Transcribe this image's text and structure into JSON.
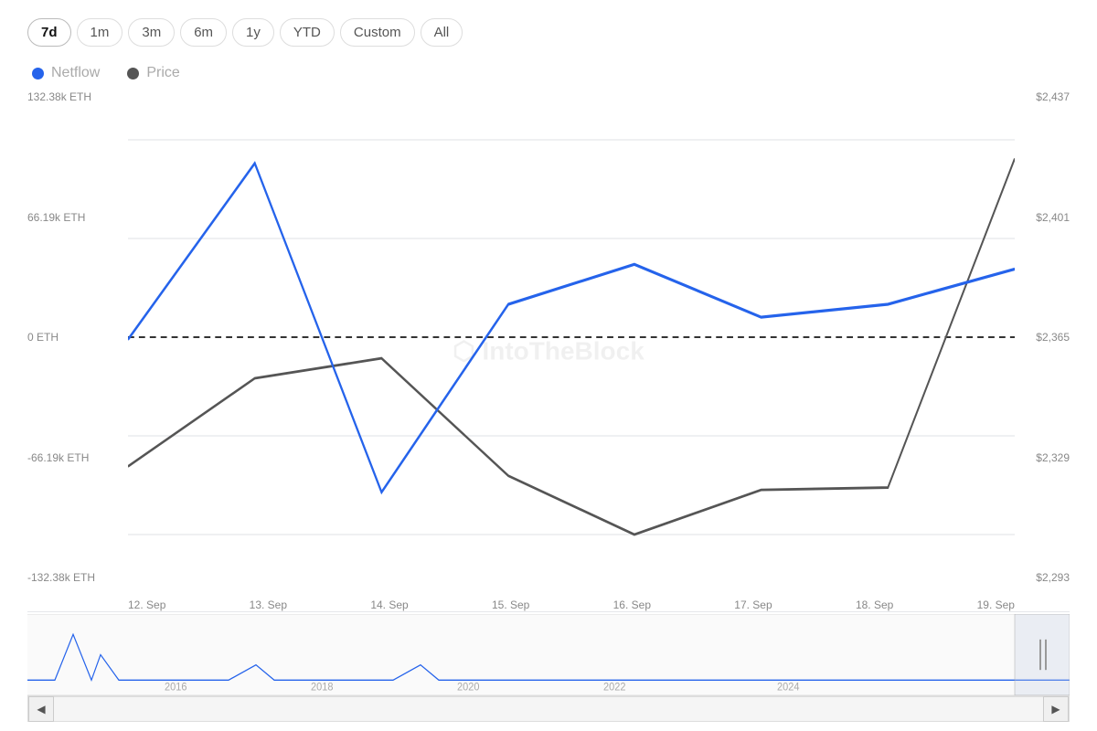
{
  "timeRange": {
    "buttons": [
      {
        "label": "7d",
        "active": true
      },
      {
        "label": "1m",
        "active": false
      },
      {
        "label": "3m",
        "active": false
      },
      {
        "label": "6m",
        "active": false
      },
      {
        "label": "1y",
        "active": false
      },
      {
        "label": "YTD",
        "active": false
      },
      {
        "label": "Custom",
        "active": false
      },
      {
        "label": "All",
        "active": false
      }
    ]
  },
  "legend": {
    "netflow": "Netflow",
    "price": "Price"
  },
  "yAxisLeft": [
    "132.38k ETH",
    "66.19k ETH",
    "0 ETH",
    "-66.19k ETH",
    "-132.38k ETH"
  ],
  "yAxisRight": [
    "$2,437",
    "$2,401",
    "$2,365",
    "$2,329",
    "$2,293"
  ],
  "xAxis": [
    "12. Sep",
    "13. Sep",
    "14. Sep",
    "15. Sep",
    "16. Sep",
    "17. Sep",
    "18. Sep",
    "19. Sep"
  ],
  "miniChart": {
    "yearLabels": [
      "2016",
      "2018",
      "2020",
      "2022",
      "2024"
    ]
  },
  "watermark": "IntoTheBlock"
}
